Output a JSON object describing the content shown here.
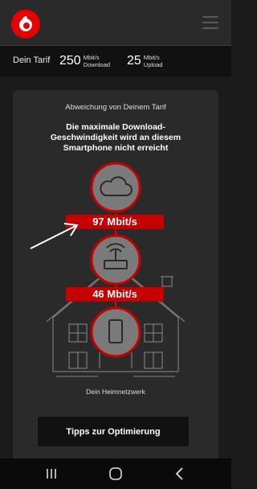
{
  "header": {
    "logo_icon": "vodafone-speechmark-logo",
    "menu_icon": "hamburger-menu-icon",
    "brand_color": "#e60000"
  },
  "tariff": {
    "label": "Dein Tarif",
    "download": {
      "value": "250",
      "unit": "Mbit/s",
      "direction": "Download"
    },
    "upload": {
      "value": "25",
      "unit": "Mbit/s",
      "direction": "Upload"
    }
  },
  "card": {
    "subtitle": "Abweichung von Deinem Tarif",
    "message": "Die maximale Download-Geschwindigkeit wird an diesem Smartphone nicht erreicht",
    "internet_speed": "97 Mbit/s",
    "wifi_speed": "46 Mbit/s",
    "home_label": "Dein Heimnetzwerk",
    "tips_button": "Tipps zur Optimierung"
  },
  "navbar": {
    "recent_icon": "recent-apps-icon",
    "home_icon": "home-icon",
    "back_icon": "back-icon"
  }
}
